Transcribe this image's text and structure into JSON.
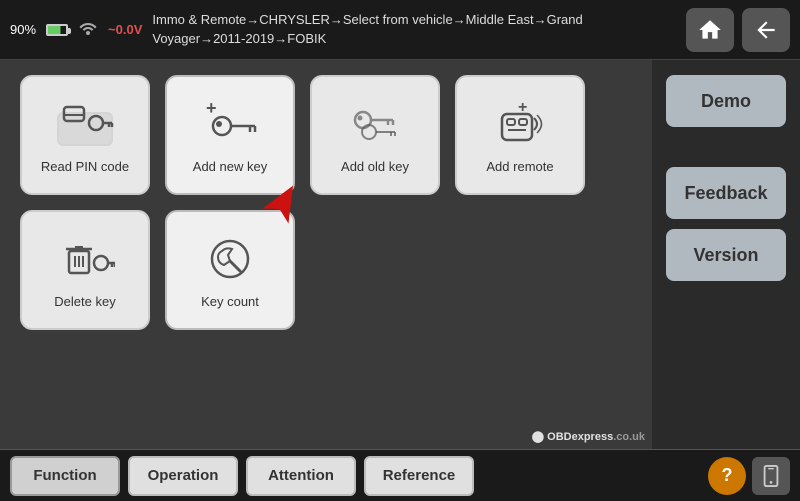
{
  "topbar": {
    "battery_pct": "90%",
    "voltage": "~0.0V",
    "breadcrumb": "Immo & Remote→CHRYSLER→Select from vehicle→Middle East→Grand Voyager→2011-2019→FOBIK"
  },
  "sidebar": {
    "demo_label": "Demo",
    "feedback_label": "Feedback",
    "version_label": "Version"
  },
  "grid": {
    "row1": [
      {
        "id": "read-pin",
        "label": "Read PIN code"
      },
      {
        "id": "add-new-key",
        "label": "Add new key"
      },
      {
        "id": "add-old-key",
        "label": "Add old key"
      },
      {
        "id": "add-remote",
        "label": "Add remote"
      }
    ],
    "row2": [
      {
        "id": "delete-key",
        "label": "Delete key"
      },
      {
        "id": "key-count",
        "label": "Key count"
      }
    ]
  },
  "bottombar": {
    "tabs": [
      {
        "id": "function",
        "label": "Function"
      },
      {
        "id": "operation",
        "label": "Operation"
      },
      {
        "id": "attention",
        "label": "Attention"
      },
      {
        "id": "reference",
        "label": "Reference"
      }
    ],
    "help_label": "?",
    "obd_logo": "OBDexpress.co.uk"
  }
}
